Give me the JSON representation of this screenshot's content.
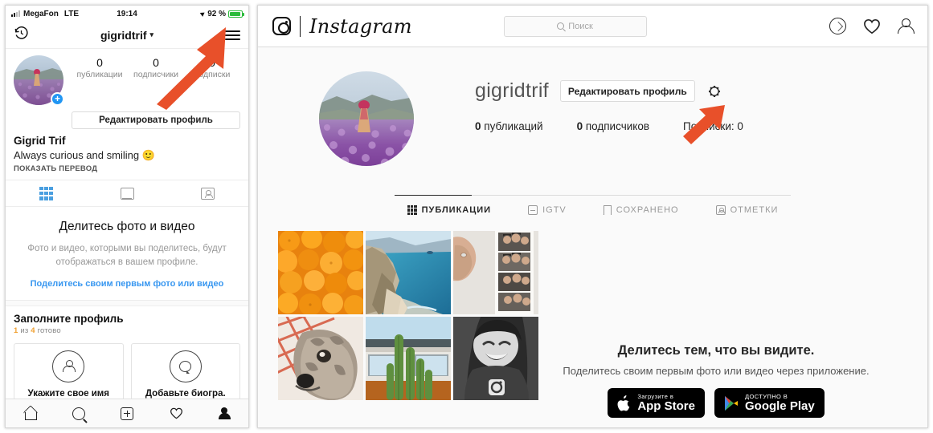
{
  "mobile": {
    "status": {
      "carrier": "MegaFon",
      "network": "LTE",
      "time": "19:14",
      "battery": "92 %"
    },
    "topbar": {
      "username": "gigridtrif",
      "history_icon": "history-clock-icon",
      "menu_icon": "hamburger-menu-icon"
    },
    "profile": {
      "avatar_alt": "lavender-field-avatar",
      "stats": [
        {
          "num": "0",
          "label": "публикации"
        },
        {
          "num": "0",
          "label": "подписчики"
        },
        {
          "num": "0",
          "label": "подписки"
        }
      ],
      "edit_button": "Редактировать профиль",
      "full_name": "Gigrid Trif",
      "bio": "Always curious and smiling 🙂",
      "translate_link": "ПОКАЗАТЬ ПЕРЕВОД"
    },
    "tabs": [
      {
        "name": "grid",
        "icon": "grid-icon",
        "active": true
      },
      {
        "name": "igtv",
        "icon": "tv-icon",
        "active": false
      },
      {
        "name": "tagged",
        "icon": "tagged-person-icon",
        "active": false
      }
    ],
    "empty_state": {
      "title": "Делитесь фото и видео",
      "text": "Фото и видео, которыми вы поделитесь, будут отображаться в вашем профиле.",
      "link": "Поделитесь своим первым фото или видео"
    },
    "complete_profile": {
      "title": "Заполните профиль",
      "progress_done": "1",
      "progress_of": "из",
      "progress_total": "4",
      "progress_word": "готово",
      "cards": [
        {
          "icon": "person-outline-icon",
          "label": "Укажите свое имя"
        },
        {
          "icon": "speech-bubble-icon",
          "label": "Добавьте биогра."
        }
      ]
    },
    "bottom_nav": [
      {
        "name": "home",
        "icon": "home-icon",
        "active": false
      },
      {
        "name": "search",
        "icon": "search-icon",
        "active": false
      },
      {
        "name": "add",
        "icon": "plus-square-icon",
        "active": false
      },
      {
        "name": "activity",
        "icon": "heart-icon",
        "active": false
      },
      {
        "name": "profile",
        "icon": "person-filled-icon",
        "active": true
      }
    ]
  },
  "desktop": {
    "header": {
      "brand": "Instagram",
      "camera_icon": "instagram-camera-icon",
      "search_placeholder": "Поиск",
      "icons": [
        {
          "name": "explore",
          "icon": "compass-icon"
        },
        {
          "name": "activity",
          "icon": "heart-icon"
        },
        {
          "name": "profile",
          "icon": "person-icon"
        }
      ]
    },
    "profile": {
      "avatar_alt": "lavender-field-avatar",
      "username": "gigridtrif",
      "edit_button": "Редактировать профиль",
      "settings_icon": "gear-icon",
      "stats": [
        {
          "value": "0",
          "label": "публикаций"
        },
        {
          "value": "0",
          "label": "подписчиков"
        },
        {
          "label_full": "Подписки: 0"
        }
      ]
    },
    "tabs": [
      {
        "label": "ПУБЛИКАЦИИ",
        "icon": "grid-icon",
        "active": true
      },
      {
        "label": "IGTV",
        "icon": "igtv-icon",
        "active": false
      },
      {
        "label": "СОХРАНЕНО",
        "icon": "bookmark-icon",
        "active": false
      },
      {
        "label": "ОТМЕТКИ",
        "icon": "tagged-icon",
        "active": false
      }
    ],
    "grid": [
      {
        "name": "oranges-photo"
      },
      {
        "name": "coastline-photo"
      },
      {
        "name": "photobooth-strip-photo"
      },
      {
        "name": "dog-photo"
      },
      {
        "name": "cactus-building-photo"
      },
      {
        "name": "baby-photo"
      }
    ],
    "cta": {
      "title": "Делитесь тем, что вы видите.",
      "text": "Поделитесь своим первым фото или видео через приложение.",
      "badges": [
        {
          "small": "Загрузите в",
          "big": "App Store",
          "icon": "apple-logo-icon"
        },
        {
          "small": "ДОСТУПНО В",
          "big": "Google Play",
          "icon": "google-play-icon"
        }
      ]
    }
  },
  "annotations": {
    "arrows": [
      {
        "name": "arrow-to-hamburger-menu",
        "color": "#e8502a"
      },
      {
        "name": "arrow-to-settings-gear",
        "color": "#e8502a"
      }
    ]
  },
  "colors": {
    "accent_blue": "#3897f0",
    "arrow_red": "#e8502a",
    "progress_orange": "#f0a030"
  }
}
